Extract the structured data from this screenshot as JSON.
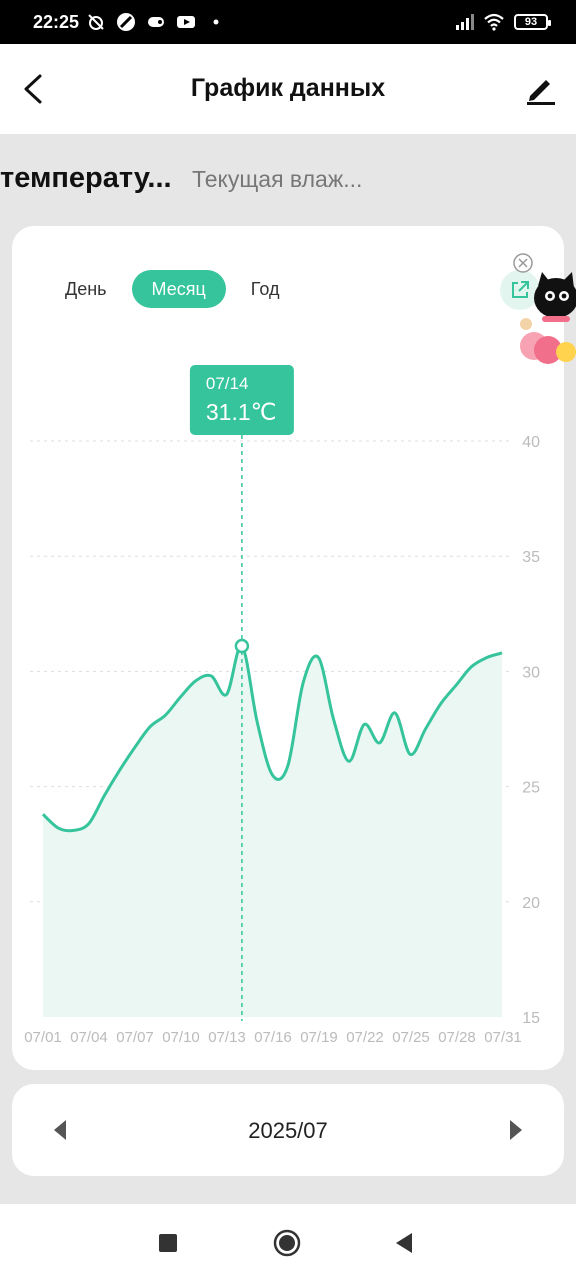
{
  "status_bar": {
    "time": "22:25",
    "battery": "93",
    "icons": [
      "alarm-off-icon",
      "no-disturb-icon",
      "game-icon",
      "youtube-icon",
      "dot-icon",
      "signal-icon",
      "wifi-icon",
      "battery-icon"
    ]
  },
  "header": {
    "title": "График данных",
    "back_icon": "chevron-left-icon",
    "edit_icon": "edit-icon"
  },
  "subtabs": {
    "active": "температу...",
    "inactive": "Текущая влаж..."
  },
  "periods": [
    {
      "label": "День",
      "active": false
    },
    {
      "label": "Месяц",
      "active": true
    },
    {
      "label": "Год",
      "active": false
    }
  ],
  "tooltip": {
    "date": "07/14",
    "value": "31.1℃"
  },
  "colors": {
    "accent": "#35c49b",
    "fill": "#eaf7f3",
    "grid": "#dddddd",
    "tick": "#bbbbbb"
  },
  "chart_data": {
    "type": "area",
    "x_labels": [
      "07/01",
      "07/04",
      "07/07",
      "07/10",
      "07/13",
      "07/16",
      "07/19",
      "07/22",
      "07/25",
      "07/28",
      "07/31"
    ],
    "y_ticks": [
      40,
      35,
      30,
      25,
      20,
      15
    ],
    "ylim": [
      15,
      40
    ],
    "grid": true,
    "series": [
      {
        "x": [
          1,
          2,
          3,
          4,
          5,
          6,
          7,
          8,
          9,
          10,
          11,
          12,
          13,
          14,
          15,
          16,
          17,
          18,
          19,
          20,
          21,
          22,
          23,
          24,
          25,
          26,
          27,
          28,
          29,
          30,
          31
        ],
        "values": [
          23.8,
          23.2,
          23.1,
          23.4,
          24.6,
          25.7,
          26.7,
          27.6,
          28.1,
          28.9,
          29.6,
          29.8,
          29.0,
          31.1,
          27.8,
          25.5,
          25.9,
          29.5,
          30.6,
          27.9,
          26.1,
          27.7,
          26.9,
          28.2,
          26.4,
          27.5,
          28.6,
          29.4,
          30.2,
          30.6,
          30.8
        ]
      }
    ],
    "highlight": {
      "x": 14,
      "value": 31.1
    }
  },
  "date_selector": {
    "value": "2025/07",
    "prev_icon": "triangle-left-icon",
    "next_icon": "triangle-right-icon"
  },
  "navbar": {
    "icons": [
      "recents-icon",
      "home-icon",
      "back-icon"
    ]
  },
  "sticker": {
    "icon": "cat-sticker-icon",
    "close_icon": "close-circle-icon"
  }
}
